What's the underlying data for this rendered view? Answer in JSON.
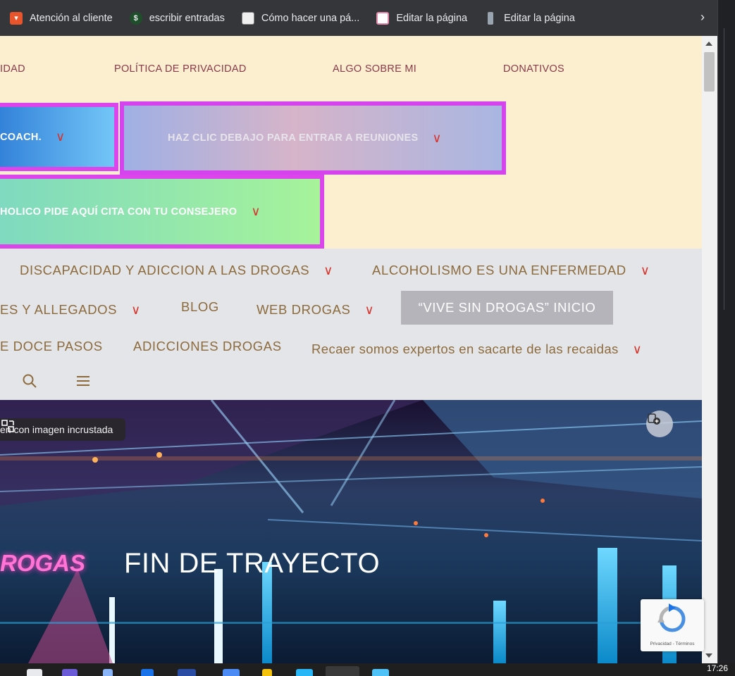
{
  "bookmarks": {
    "items": [
      {
        "label": "Atención al cliente",
        "icon": "storefront-icon",
        "color": "#e8542c"
      },
      {
        "label": "escribir entradas",
        "icon": "dollar-icon",
        "color": "#1f4f2a"
      },
      {
        "label": "Cómo hacer una pá...",
        "icon": "page-icon",
        "color": "#f0f0f0"
      },
      {
        "label": "Editar la página",
        "icon": "site-icon",
        "color": "#e48aa8"
      },
      {
        "label": "Editar la página",
        "icon": "pin-icon",
        "color": "#9aa3b0"
      }
    ],
    "more_glyph": "›"
  },
  "topnav": {
    "links": [
      "IDAD",
      "POLÍTICA DE PRIVACIDAD",
      "ALGO SOBRE MI",
      "DONATIVOS"
    ]
  },
  "mega": {
    "m1": "COACH.",
    "m2": "HAZ CLIC DEBAJO PARA ENTRAR A REUNIONES",
    "m3": "HOLICO PIDE AQUÍ CITA CON TU CONSEJERO",
    "border_color": "#db45eb"
  },
  "mainnav": {
    "row1": [
      "DISCAPACIDAD Y ADICCION A LAS DROGAS",
      "ALCOHOLISMO ES UNA ENFERMEDAD"
    ],
    "row2": [
      "ES Y ALLEGADOS",
      "BLOG",
      "WEB DROGAS"
    ],
    "button": "“VIVE SIN DROGAS” INICIO",
    "row3": [
      "E DOCE PASOS",
      "ADICCIONES DROGAS",
      "Recaer somos expertos en sacarte de las recaidas"
    ],
    "text_color": "#8c6a3c",
    "chevron_color": "#d7342c"
  },
  "hero": {
    "chip_label": "en con imagen incrustada",
    "neon_text": "ROGAS",
    "title": "FIN DE TRAYECTO"
  },
  "recaptcha": {
    "footer": "Privacidad - Términos"
  },
  "taskbar": {
    "clock": "17:26"
  }
}
